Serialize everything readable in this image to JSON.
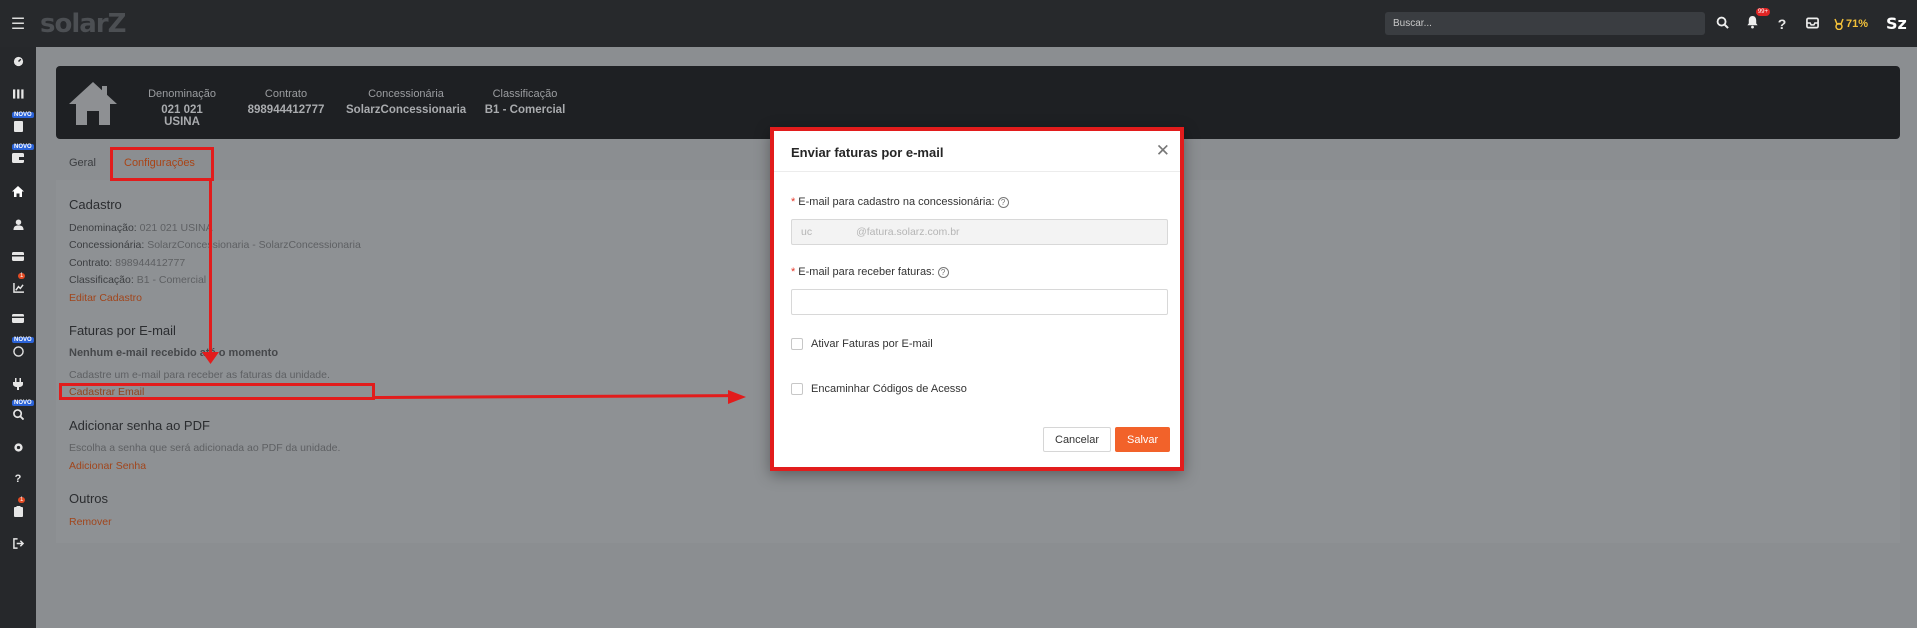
{
  "topbar": {
    "logo": "solarZ",
    "search_placeholder": "Buscar...",
    "notification_count": "99+",
    "progress_percent": "71%"
  },
  "header": {
    "fields": [
      {
        "label": "Denominação",
        "value": "021 021 USINA"
      },
      {
        "label": "Contrato",
        "value": "898944412777"
      },
      {
        "label": "Concessionária",
        "value": "SolarzConcessionaria"
      },
      {
        "label": "Classificação",
        "value": "B1 - Comercial"
      }
    ]
  },
  "tabs": [
    "Geral",
    "Configurações"
  ],
  "cadastro": {
    "title": "Cadastro",
    "rows": [
      {
        "label": "Denominação:",
        "value": "021 021 USINA"
      },
      {
        "label": "Concessionária:",
        "value": "SolarzConcessionaria - SolarzConcessionaria"
      },
      {
        "label": "Contrato:",
        "value": "898944412777"
      },
      {
        "label": "Classificação:",
        "value": "B1 - Comercial"
      }
    ],
    "link": "Editar Cadastro"
  },
  "faturas": {
    "title": "Faturas por E-mail",
    "empty": "Nenhum e-mail recebido até o momento",
    "hint": "Cadastre um e-mail para receber as faturas da unidade.",
    "link": "Cadastrar Email"
  },
  "senha": {
    "title": "Adicionar senha ao PDF",
    "hint": "Escolha a senha que será adicionada ao PDF da unidade.",
    "link": "Adicionar Senha"
  },
  "outros": {
    "title": "Outros",
    "link": "Remover"
  },
  "modal": {
    "title": "Enviar faturas por e-mail",
    "field1_label": "E-mail para cadastro na concessionária:",
    "field1_prefix": "uc",
    "field1_suffix": "@fatura.solarz.com.br",
    "field2_label": "E-mail para receber faturas:",
    "field2_value": "",
    "check1_label": "Ativar Faturas por E-mail",
    "check2_label": "Encaminhar Códigos de Acesso",
    "cancel_label": "Cancelar",
    "save_label": "Salvar"
  },
  "sidebar": {
    "new_badge": "NOVO",
    "badge_count": "1"
  },
  "colors": {
    "accent": "#f2622a",
    "annotation": "#e21c1c",
    "topbar": "#27292c"
  }
}
